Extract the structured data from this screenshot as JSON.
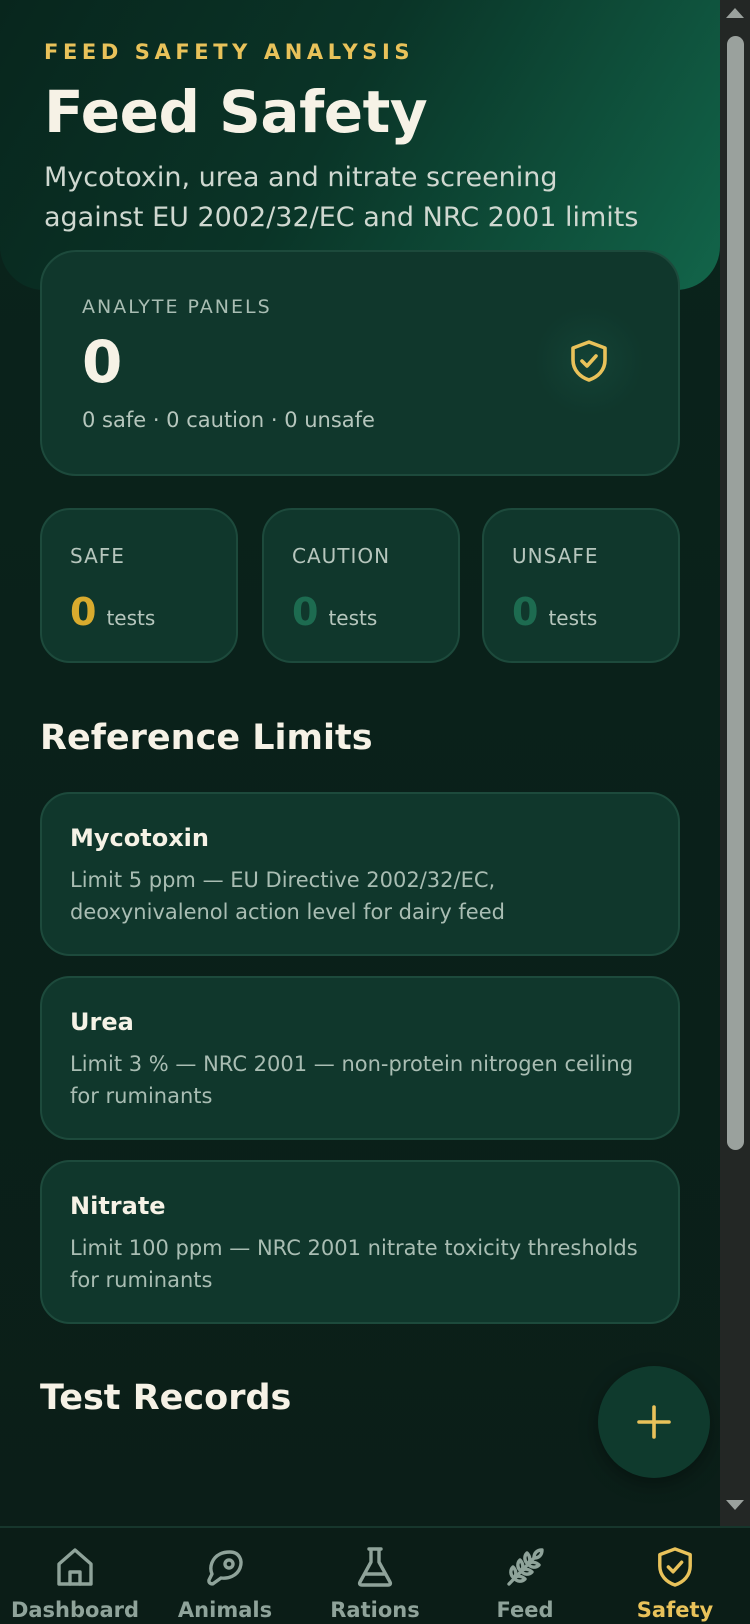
{
  "header": {
    "eyebrow": "FEED SAFETY ANALYSIS",
    "title": "Feed Safety",
    "subtitle": "Mycotoxin, urea and nitrate screening against EU 2002/32/EC and NRC 2001 limits"
  },
  "summary": {
    "label": "ANALYTE PANELS",
    "value": "0",
    "breakdown": "0 safe · 0 caution · 0 unsafe",
    "icon": "shield-check-icon"
  },
  "stats": [
    {
      "label": "SAFE",
      "value": "0",
      "unit": "tests",
      "color": "#d9ab2e"
    },
    {
      "label": "CAUTION",
      "value": "0",
      "unit": "tests",
      "color": "#1d6b50"
    },
    {
      "label": "UNSAFE",
      "value": "0",
      "unit": "tests",
      "color": "#1d6b50"
    }
  ],
  "reference": {
    "title": "Reference Limits",
    "items": [
      {
        "name": "Mycotoxin",
        "desc": "Limit 5 ppm — EU Directive 2002/32/EC, deoxynivalenol action level for dairy feed"
      },
      {
        "name": "Urea",
        "desc": "Limit 3 % — NRC 2001 — non-protein nitrogen ceiling for ruminants"
      },
      {
        "name": "Nitrate",
        "desc": "Limit 100 ppm — NRC 2001 nitrate toxicity thresholds for ruminants"
      }
    ]
  },
  "records": {
    "title": "Test Records"
  },
  "fab": {
    "icon": "plus-icon"
  },
  "nav": {
    "items": [
      {
        "label": "Dashboard",
        "icon": "home-icon"
      },
      {
        "label": "Animals",
        "icon": "meat-icon"
      },
      {
        "label": "Rations",
        "icon": "flask-icon"
      },
      {
        "label": "Feed",
        "icon": "wheat-icon"
      },
      {
        "label": "Safety",
        "icon": "shield-check-icon",
        "active": true
      }
    ]
  },
  "colors": {
    "accent": "#e9c25a",
    "background": "#0a211a",
    "card": "#10372c"
  }
}
